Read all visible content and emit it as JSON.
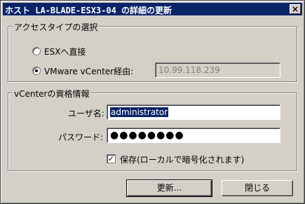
{
  "window": {
    "title": "ホスト LA-BLADE-ESX3-04 の詳細の更新",
    "close_glyph": "×"
  },
  "access_type": {
    "legend": "アクセスタイプの選択",
    "option_direct": "ESXへ直接",
    "option_vcenter": "VMware vCenter経由:",
    "selected": "vcenter",
    "vcenter_address": "10.99.118.239"
  },
  "credentials": {
    "legend": "vCenterの資格情報",
    "username_label": "ユーザ名:",
    "username_value": "administrator",
    "password_label": "パスワード:",
    "password_value": "●●●●●●●●",
    "save_label": "保存(ローカルで暗号化されます)",
    "save_checked": true,
    "check_glyph": "✓"
  },
  "buttons": {
    "update": "更新...",
    "close": "閉じる"
  }
}
